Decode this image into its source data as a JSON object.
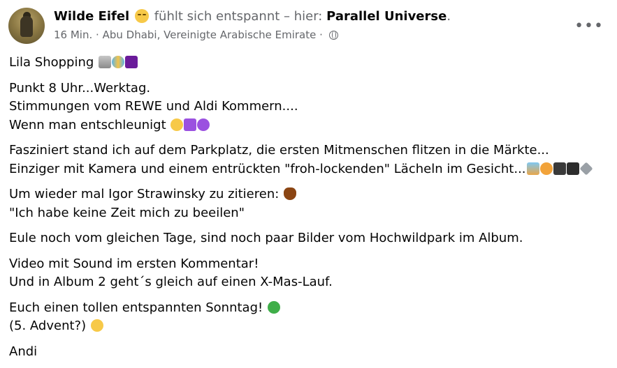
{
  "post": {
    "author": "Wilde Eifel",
    "feeling_text": "fühlt sich entspannt – hier:",
    "place": "Parallel Universe",
    "place_suffix": ".",
    "time": "16 Min.",
    "separator": "·",
    "location": "Abu Dhabi, Vereinigte Arabische Emirate",
    "separator2": "·",
    "audience_icon": "globe-icon",
    "more_label": "•••"
  },
  "content": {
    "p1_l1": "Lila Shopping",
    "p2_l1": "Punkt 8 Uhr...Werktag.",
    "p2_l2": "Stimmungen vom REWE und Aldi Kommern....",
    "p2_l3": "Wenn man entschleunigt",
    "p3_l1": "Fasziniert stand ich auf dem Parkplatz, die ersten Mitmenschen flitzen in die Märkte...",
    "p3_l2": "Einziger mit Kamera und einem entrückten \"froh-lockenden\" Lächeln im Gesicht...",
    "p4_l1": "Um wieder mal Igor Strawinsky zu zitieren:",
    "p4_l2": "\"Ich habe keine Zeit mich zu beeilen\"",
    "p5_l1": "Eule noch vom gleichen Tage, sind noch paar Bilder vom Hochwildpark im Album.",
    "p6_l1": "Video mit Sound im ersten Kommentar!",
    "p6_l2": "Und in Album 2 geht´s gleich auf einen X-Mas-Lauf.",
    "p7_l1": "Euch einen tollen entspannten Sonntag!",
    "p7_l2": "(5. Advent?)",
    "p8_l1": "Andi"
  }
}
